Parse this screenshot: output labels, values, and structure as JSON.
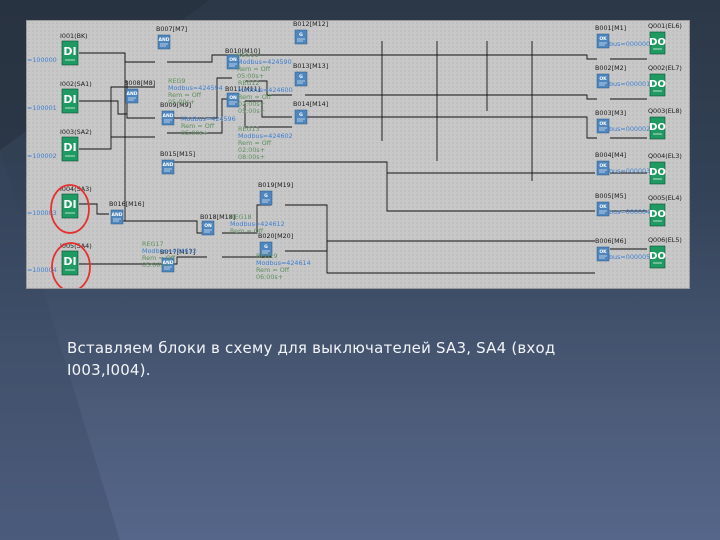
{
  "caption": "Вставляем блоки в схему для выключателей SA3, SA4 (вход I003,I004).",
  "theme": {
    "canvas_bg": "#c8c8c8",
    "block_color": "#1e9a62",
    "gate_color": "#4f86bd",
    "highlight_circle": "#e53030",
    "param_text": "#5e8f5e",
    "modbus_text": "#3d7fd1"
  },
  "inputs": [
    {
      "title": "I001(BK)",
      "glyph": "DI",
      "number": "=100000"
    },
    {
      "title": "I002(SA1)",
      "glyph": "DI",
      "number": "=100001"
    },
    {
      "title": "I003(SA2)",
      "glyph": "DI",
      "number": "=100002"
    },
    {
      "title": "I004(SA3)",
      "glyph": "DI",
      "number": "=100003"
    },
    {
      "title": "I005(SA4)",
      "glyph": "DI",
      "number": "=100004"
    }
  ],
  "and_blocks": [
    {
      "title": "B007[M7]",
      "glyph": "AND"
    },
    {
      "title": "B008[M8]",
      "glyph": "AND"
    },
    {
      "title": "B009[M9]",
      "glyph": "AND"
    },
    {
      "title": "B015[M15]",
      "glyph": "AND"
    },
    {
      "title": "B016[M16]",
      "glyph": "AND"
    },
    {
      "title": "B017[M17]",
      "glyph": "AND"
    }
  ],
  "timer_blocks": [
    {
      "title": "B010[M10]",
      "glyph": "ON"
    },
    {
      "title": "B011[M11]",
      "glyph": "ON"
    },
    {
      "title": "B018[M18]",
      "glyph": "ON"
    }
  ],
  "g_blocks": [
    {
      "title": "B012[M12]",
      "glyph": "G"
    },
    {
      "title": "B013[M13]",
      "glyph": "G"
    },
    {
      "title": "B014[M14]",
      "glyph": "G"
    },
    {
      "title": "B019[M19]",
      "glyph": "G"
    },
    {
      "title": "B020[M20]",
      "glyph": "G"
    }
  ],
  "memory_blocks": [
    {
      "title": "B001[M1]",
      "number": "bus=000000"
    },
    {
      "title": "B002[M2]",
      "number": "bus=000001"
    },
    {
      "title": "B003[M3]",
      "number": "bus=000002"
    },
    {
      "title": "B004[M4]",
      "number": "bus=000003"
    },
    {
      "title": "B005[M5]",
      "number": "bus=000004"
    },
    {
      "title": "B006[M6]",
      "number": "bus=000005"
    }
  ],
  "outputs": [
    {
      "title": "Q001(EL6)",
      "glyph": "DO"
    },
    {
      "title": "Q002(EL7)",
      "glyph": "DO"
    },
    {
      "title": "Q003(EL8)",
      "glyph": "DO"
    },
    {
      "title": "Q004(EL3)",
      "glyph": "DO"
    },
    {
      "title": "Q005(EL4)",
      "glyph": "DO"
    },
    {
      "title": "Q006(EL5)",
      "glyph": "DO"
    }
  ],
  "params": [
    {
      "lines": [
        "REG11",
        "Modbus=424590",
        "Rem = Off",
        "05:00s+"
      ]
    },
    {
      "lines": [
        "REG9",
        "Modbus=424594",
        "Rem = Off",
        "05:00s+"
      ]
    },
    {
      "lines": [
        "REG12",
        "Modbus=424600",
        "Rem = Off",
        "02:00s+",
        "05:00s+"
      ]
    },
    {
      "lines": [
        "Modbus=424596",
        "Rem = Off",
        "05:00s+"
      ]
    },
    {
      "lines": [
        "REG13",
        "Modbus=424602",
        "Rem = Off",
        "02:00s+",
        "08:00s+"
      ]
    },
    {
      "lines": [
        "REG17",
        "Modbus=424612",
        "Rem = Off",
        "05:00s+"
      ]
    },
    {
      "lines": [
        "REG19",
        "Modbus=424614",
        "Rem = Off",
        "06:00s+"
      ]
    },
    {
      "lines": [
        "REG18",
        "Modbus=424612",
        "Rem = Off"
      ]
    }
  ]
}
